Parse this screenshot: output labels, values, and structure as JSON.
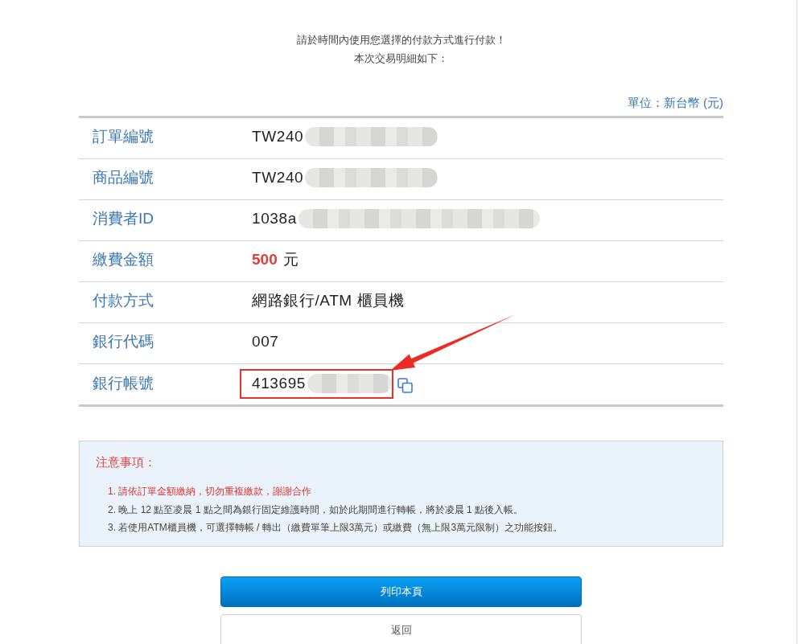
{
  "intro": [
    "請於時間內使用您選擇的付款方式進行付款！",
    "本次交易明細如下："
  ],
  "unit_label": "單位：新台幣 (元)",
  "details": [
    {
      "kind": "text",
      "label": "訂單編號",
      "value": "TW240",
      "redacted": true,
      "highlighted": false
    },
    {
      "kind": "text",
      "label": "商品編號",
      "value": "TW240",
      "redacted": true,
      "highlighted": false
    },
    {
      "kind": "text",
      "label": "消費者ID",
      "value": "1038a",
      "redacted": true,
      "highlighted": false
    },
    {
      "kind": "amount",
      "label": "繳費金額",
      "value": "500",
      "unit": "元",
      "redacted": false,
      "highlighted": false
    },
    {
      "kind": "text",
      "label": "付款方式",
      "value": "網路銀行/ATM 櫃員機",
      "redacted": false,
      "highlighted": false
    },
    {
      "kind": "text",
      "label": "銀行代碼",
      "value": "007",
      "redacted": false,
      "highlighted": false
    },
    {
      "kind": "account",
      "label": "銀行帳號",
      "value": "413695",
      "redacted": true,
      "highlighted": true
    }
  ],
  "notice": {
    "title": "注意事項：",
    "items": [
      {
        "text": "1. 請依訂單金額繳納，切勿重複繳款，謝謝合作",
        "important": true
      },
      {
        "text": "2. 晚上 12 點至凌晨 1 點之間為銀行固定維護時間，如於此期間進行轉帳，將於凌晨 1 點後入帳。",
        "important": false
      },
      {
        "text": "3. 若使用ATM櫃員機，可選擇轉帳 / 轉出（繳費單筆上限3萬元）或繳費（無上限3萬元限制）之功能按鈕。",
        "important": false
      }
    ]
  },
  "buttons": [
    {
      "kind": "primary",
      "label": "列印本頁"
    },
    {
      "kind": "secondary",
      "label": "返回"
    }
  ]
}
